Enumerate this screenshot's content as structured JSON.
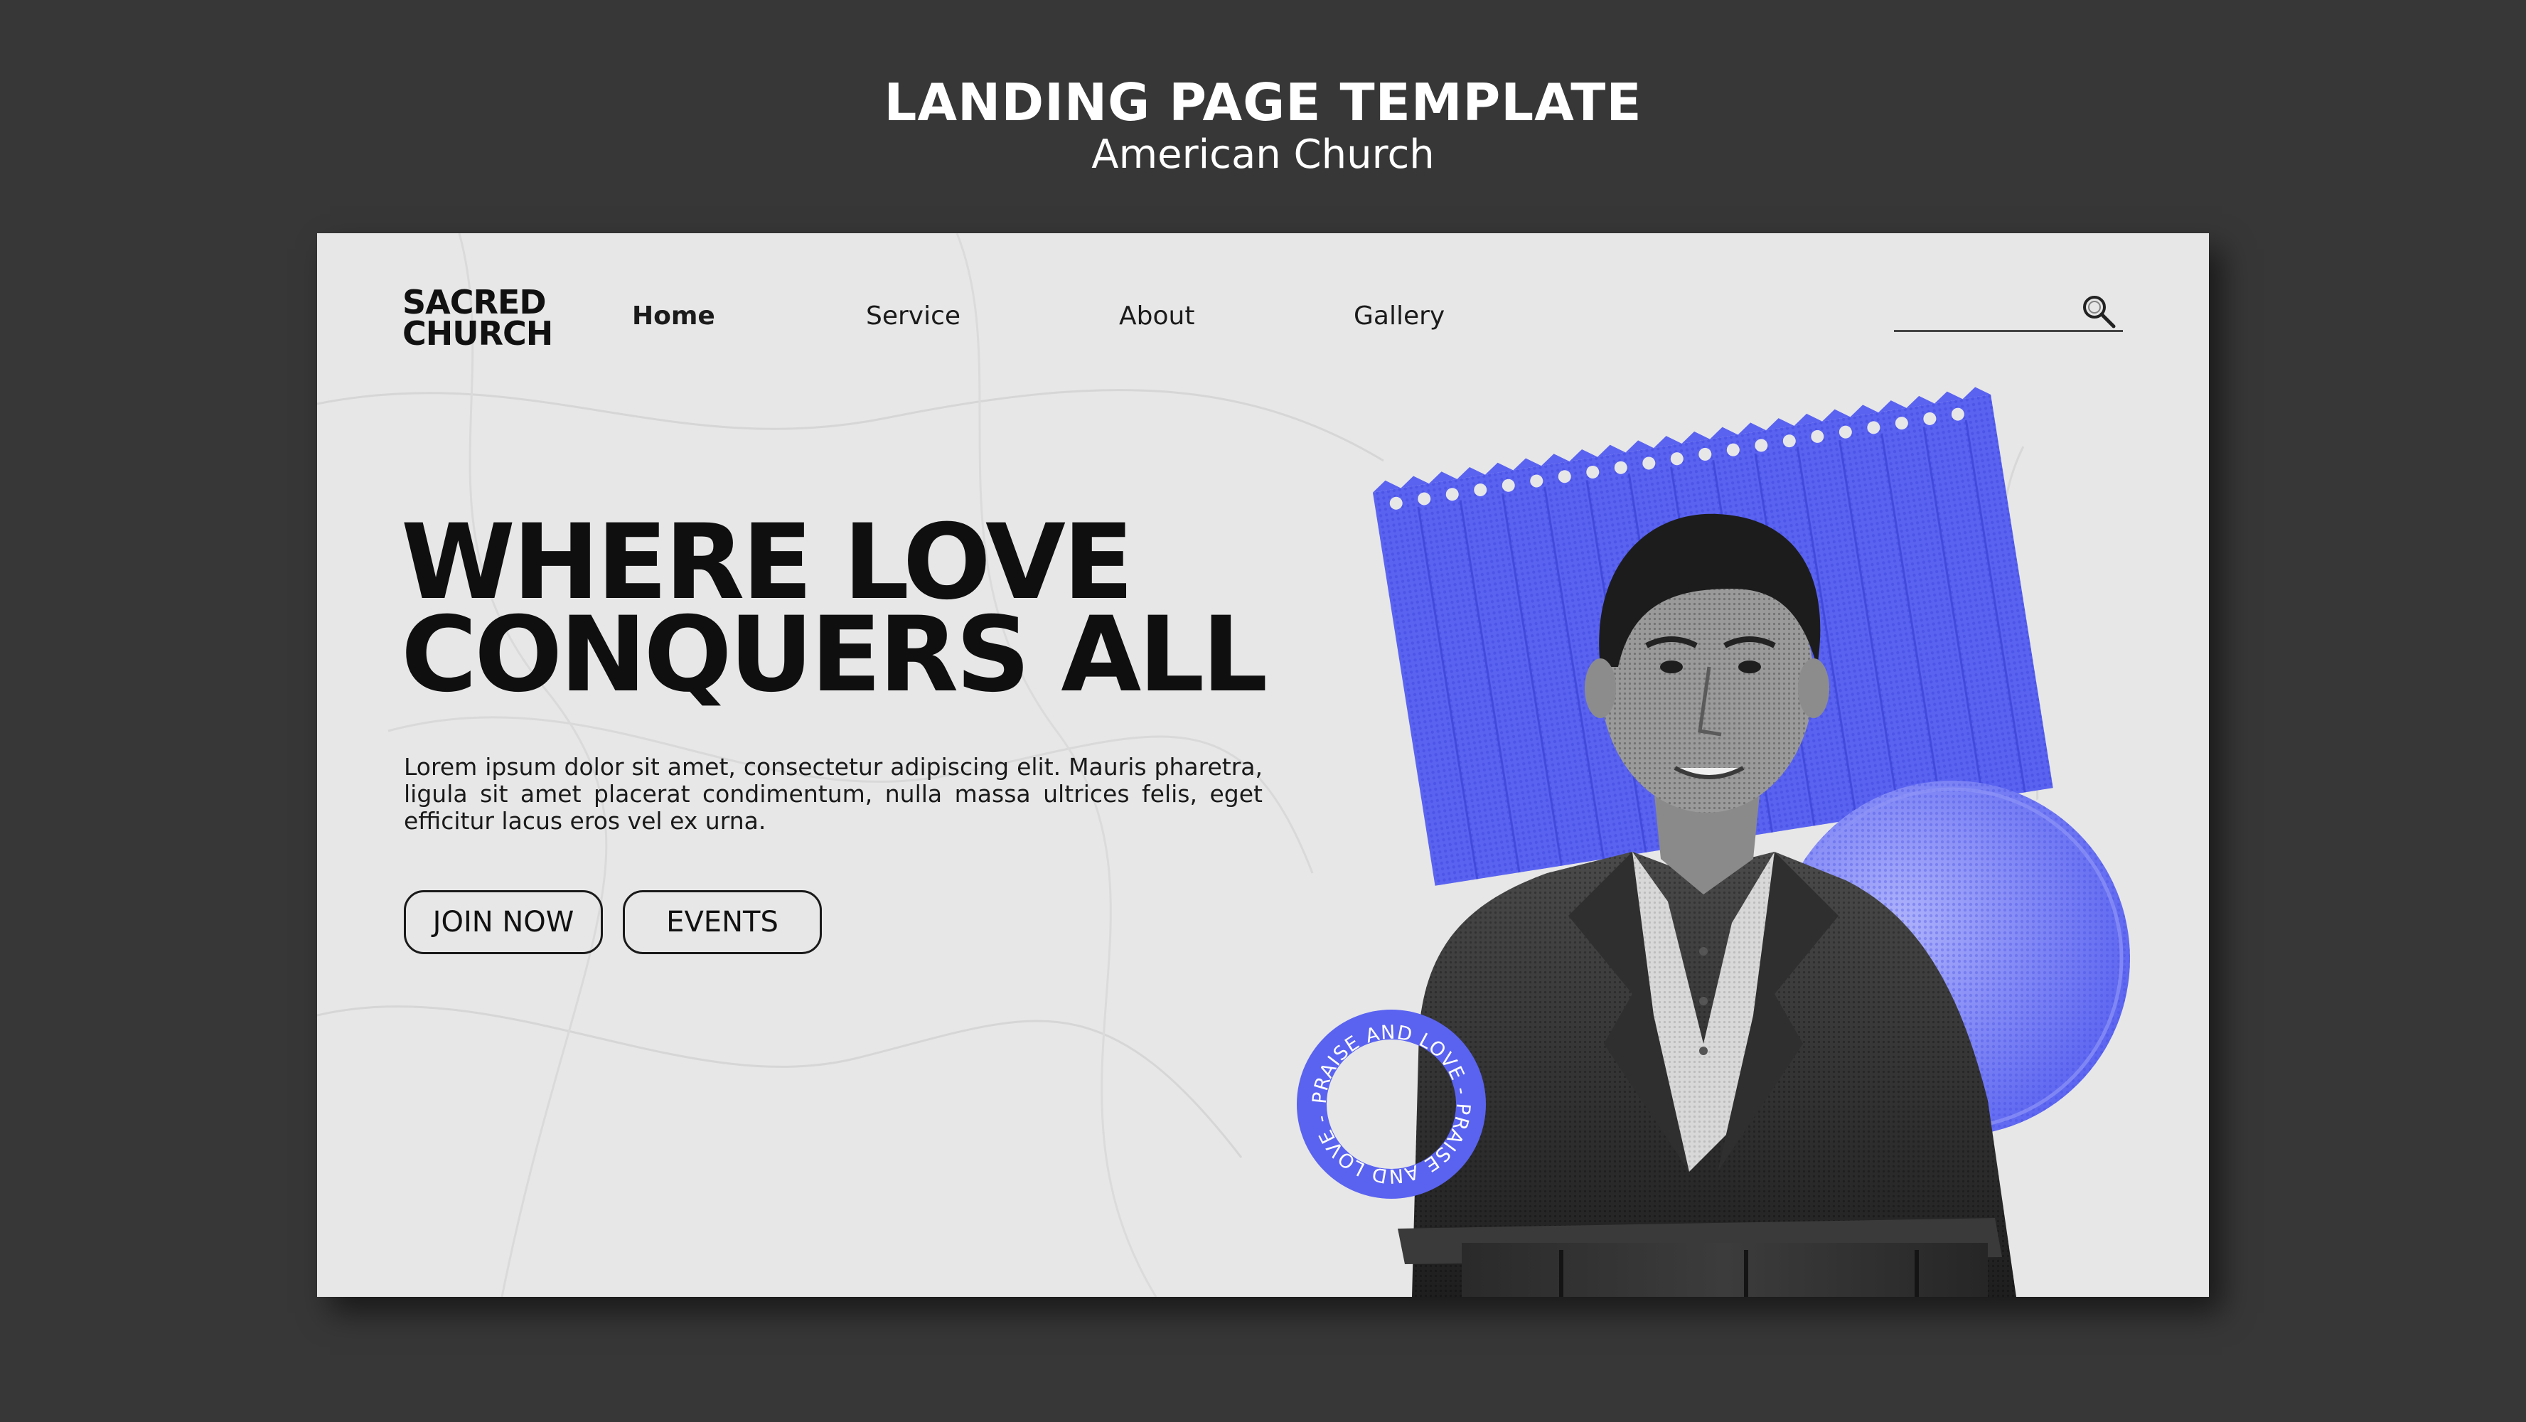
{
  "showcase": {
    "title": "LANDING PAGE TEMPLATE",
    "subtitle": "American Church"
  },
  "header": {
    "logo_line1": "SACRED",
    "logo_line2": "CHURCH",
    "nav": [
      {
        "label": "Home",
        "active": true
      },
      {
        "label": "Service",
        "active": false
      },
      {
        "label": "About",
        "active": false
      },
      {
        "label": "Gallery",
        "active": false
      }
    ],
    "search": {
      "placeholder": "",
      "icon": "search-icon"
    }
  },
  "hero": {
    "title_line1": "WHERE LOVE",
    "title_line2": "CONQUERS ALL",
    "body": "Lorem ipsum dolor sit amet, consectetur adipiscing elit. Mauris pharetra, ligula sit amet placerat condimentum, nulla massa ultrices felis, eget efficitur lacus eros vel ex urna.",
    "buttons": {
      "join": "JOIN NOW",
      "events": "EVENTS"
    },
    "badge_text": "PRAISE AND LOVE - PRAISE AND LOVE - PRAISE AND LOVE - "
  },
  "colors": {
    "accent_blue": "#5a63f0",
    "background_outer": "#373737",
    "page_background": "#e7e7e7",
    "text_dark": "#111111"
  }
}
